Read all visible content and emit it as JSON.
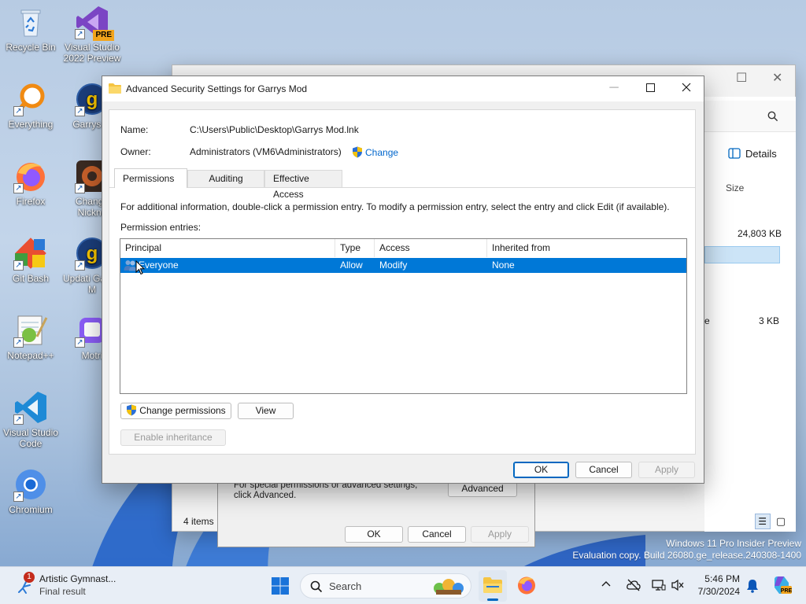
{
  "desktop": {
    "icons": [
      {
        "label": "Recycle Bin"
      },
      {
        "label": "Visual Studio 2022 Preview",
        "badge": "PRE"
      },
      {
        "label": "Everything"
      },
      {
        "label": "Garrys M"
      },
      {
        "label": "Firefox"
      },
      {
        "label": "Change Nickna"
      },
      {
        "label": "Git Bash"
      },
      {
        "label": "Updati Garrys M"
      },
      {
        "label": "Notepad++"
      },
      {
        "label": "Motri"
      },
      {
        "label": "Visual Studio Code"
      },
      {
        "label": "Chromium"
      }
    ]
  },
  "explorer": {
    "details_label": "Details",
    "size_header": "Size",
    "row1_size": "24,803 KB",
    "row2_size": "3 KB",
    "row2_frag": "e",
    "status": "4 items"
  },
  "props_dialog": {
    "text": "For special permissions or advanced settings, click Advanced.",
    "advanced_btn": "Advanced",
    "ok": "OK",
    "cancel": "Cancel",
    "apply": "Apply"
  },
  "dialog": {
    "title": "Advanced Security Settings for Garrys Mod",
    "name_label": "Name:",
    "name_value": "C:\\Users\\Public\\Desktop\\Garrys Mod.lnk",
    "owner_label": "Owner:",
    "owner_value": "Administrators (VM6\\Administrators)",
    "change_link": "Change",
    "tabs": [
      "Permissions",
      "Auditing",
      "Effective Access"
    ],
    "info_text": "For additional information, double-click a permission entry. To modify a permission entry, select the entry and click Edit (if available).",
    "entries_label": "Permission entries:",
    "columns": [
      "Principal",
      "Type",
      "Access",
      "Inherited from"
    ],
    "rows": [
      {
        "principal": "Everyone",
        "type": "Allow",
        "access": "Modify",
        "inherited": "None"
      }
    ],
    "change_permissions_btn": "Change permissions",
    "view_btn": "View",
    "enable_inheritance_btn": "Enable inheritance",
    "ok": "OK",
    "cancel": "Cancel",
    "apply": "Apply"
  },
  "watermark": {
    "line1": "Windows 11 Pro Insider Preview",
    "line2": "Evaluation copy. Build 26080.ge_release.240308-1400"
  },
  "taskbar": {
    "notification_title": "Artistic Gymnast...",
    "notification_sub": "Final result",
    "notification_badge": "1",
    "search_placeholder": "Search",
    "time": "5:46 PM",
    "date": "7/30/2024"
  },
  "colors": {
    "selection": "#0078d7",
    "link": "#0066cc",
    "accent": "#0067c0"
  }
}
